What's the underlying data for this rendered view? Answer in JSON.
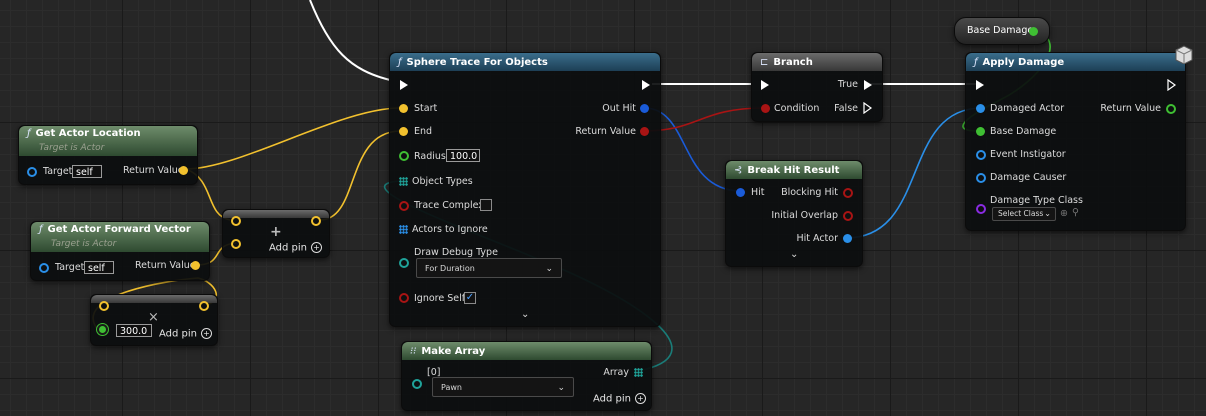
{
  "colors": {
    "exec": "#ffffff",
    "vector": "#f2c12e",
    "object": "#2a8fe8",
    "struct": "#1a5bd8",
    "bool": "#a81414",
    "float": "#5fd14e",
    "class": "#8a2be2",
    "array": "#1fa39a"
  },
  "get_actor_location": {
    "title": "Get Actor Location",
    "subtitle": "Target is Actor",
    "target_label": "Target",
    "target_value": "self",
    "return_label": "Return Value"
  },
  "get_forward_vector": {
    "title": "Get Actor Forward Vector",
    "subtitle": "Target is Actor",
    "target_label": "Target",
    "target_value": "self",
    "return_label": "Return Value"
  },
  "add_node_1": {
    "add_pin": "Add pin",
    "plus_icon": "+"
  },
  "multiply_node": {
    "value": "300.0",
    "add_pin": "Add pin",
    "close_icon": "×"
  },
  "sphere_trace": {
    "title": "Sphere Trace For Objects",
    "start": "Start",
    "end": "End",
    "radius_label": "Radius",
    "radius_value": "100.0",
    "object_types": "Object Types",
    "trace_complex": "Trace Complex",
    "actors_to_ignore": "Actors to Ignore",
    "draw_debug_label": "Draw Debug Type",
    "draw_debug_value": "For Duration",
    "ignore_self": "Ignore Self",
    "out_hit": "Out Hit",
    "return_value": "Return Value"
  },
  "make_array": {
    "title": "Make Array",
    "index": "[0]",
    "value": "Pawn",
    "array_label": "Array",
    "add_pin": "Add pin"
  },
  "branch": {
    "title": "Branch",
    "condition": "Condition",
    "true_label": "True",
    "false_label": "False"
  },
  "break_hit": {
    "title": "Break Hit Result",
    "hit": "Hit",
    "blocking_hit": "Blocking Hit",
    "initial_overlap": "Initial Overlap",
    "hit_actor": "Hit Actor"
  },
  "base_damage": {
    "title": "Base Damage"
  },
  "apply_damage": {
    "title": "Apply Damage",
    "damaged_actor": "Damaged Actor",
    "base_damage": "Base Damage",
    "event_instigator": "Event Instigator",
    "damage_causer": "Damage Causer",
    "damage_type_class": "Damage Type Class",
    "select_class": "Select Class",
    "return_value": "Return Value"
  }
}
